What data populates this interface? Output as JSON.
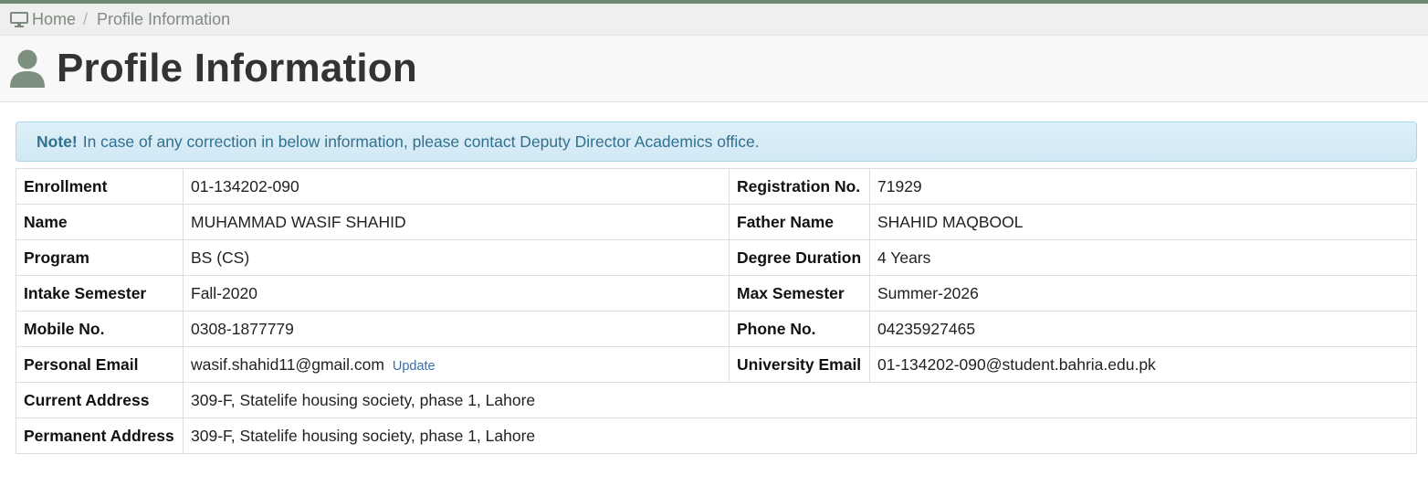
{
  "breadcrumb": {
    "home_label": "Home",
    "separator": "/",
    "current": "Profile Information"
  },
  "header": {
    "title": "Profile Information",
    "icon": "user-icon"
  },
  "note": {
    "label": "Note!",
    "text": "In case of any correction in below information, please contact Deputy Director Academics office."
  },
  "profile": {
    "enrollment": {
      "label": "Enrollment",
      "value": "01-134202-090"
    },
    "registration_no": {
      "label": "Registration No.",
      "value": "71929"
    },
    "name": {
      "label": "Name",
      "value": "MUHAMMAD WASIF SHAHID"
    },
    "father_name": {
      "label": "Father Name",
      "value": "SHAHID MAQBOOL"
    },
    "program": {
      "label": "Program",
      "value": "BS (CS)"
    },
    "degree_duration": {
      "label": "Degree Duration",
      "value": "4 Years"
    },
    "intake_semester": {
      "label": "Intake Semester",
      "value": "Fall-2020"
    },
    "max_semester": {
      "label": "Max Semester",
      "value": "Summer-2026"
    },
    "mobile_no": {
      "label": "Mobile No.",
      "value": "0308-1877779"
    },
    "phone_no": {
      "label": "Phone No.",
      "value": "04235927465"
    },
    "personal_email": {
      "label": "Personal Email",
      "value": "wasif.shahid11@gmail.com",
      "update_label": "Update"
    },
    "university_email": {
      "label": "University Email",
      "value": "01-134202-090@student.bahria.edu.pk"
    },
    "current_address": {
      "label": "Current Address",
      "value": "309-F, Statelife housing society, phase 1, Lahore"
    },
    "permanent_address": {
      "label": "Permanent Address",
      "value": "309-F, Statelife housing society, phase 1, Lahore"
    }
  },
  "colors": {
    "accent": "#6e8770",
    "alert_bg": "#d9edf7",
    "alert_text": "#31708f",
    "link": "#3f6ea5"
  }
}
